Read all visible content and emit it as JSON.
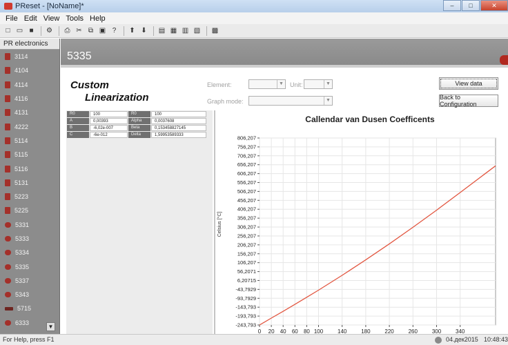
{
  "window": {
    "title": "PReset - [NoName]*",
    "controls": {
      "minimize": "–",
      "maximize": "□",
      "close": "✕"
    }
  },
  "menu": [
    "File",
    "Edit",
    "View",
    "Tools",
    "Help"
  ],
  "toolbar": {
    "icons": [
      "new-icon",
      "open-icon",
      "save-icon",
      "config-icon",
      "print-icon",
      "cut-icon",
      "copy-icon",
      "paste-icon",
      "help-icon",
      "upload-icon",
      "download-icon",
      "view-1-icon",
      "view-2-icon",
      "view-3-icon",
      "view-4-icon",
      "monitor-icon"
    ],
    "glyphs": [
      "□",
      "▭",
      "■",
      "⚙",
      "⎙",
      "✂",
      "⧉",
      "▣",
      "?",
      "⬆",
      "⬇",
      "▤",
      "▦",
      "▥",
      "▧",
      "▩"
    ]
  },
  "sidebar": {
    "header": "PR electronics",
    "items": [
      "3114",
      "4104",
      "4114",
      "4116",
      "4131",
      "4222",
      "5114",
      "5115",
      "5116",
      "5131",
      "5223",
      "5225",
      "5331",
      "5333",
      "5334",
      "5335",
      "5337",
      "5343",
      "5715",
      "6333"
    ],
    "icon_types": [
      "rect",
      "rect",
      "rect",
      "rect",
      "rect",
      "rect",
      "rect",
      "rect",
      "rect",
      "rect",
      "rect",
      "rect",
      "round",
      "round",
      "round",
      "round",
      "round",
      "round",
      "bar",
      "round"
    ],
    "scroll_glyph": "▼"
  },
  "header": {
    "device_number": "5335"
  },
  "panel": {
    "title_line1": "Custom",
    "title_line2": "Linearization",
    "element_label": "Element:",
    "unit_label": "Unit:",
    "graph_mode_label": "Graph mode:",
    "select_arrow": "▼",
    "view_data_button": "View data",
    "back_button": "Back to Configuration"
  },
  "coefficients": [
    {
      "k1": "R0",
      "v1": "100",
      "k2": "R0",
      "v2": "100"
    },
    {
      "k1": "A",
      "v1": "0,00393",
      "k2": "Alpha",
      "v2": "0,0037608"
    },
    {
      "k1": "B",
      "v1": "-6,02e-007",
      "k2": "Beta",
      "v2": "0,153458827145"
    },
    {
      "k1": "C",
      "v1": "-6e-012",
      "k2": "Delta",
      "v2": "1,59953589333"
    }
  ],
  "status": {
    "help_text": "For Help, press F1",
    "date": "04.дек2015",
    "time": "10:48:43"
  },
  "chart_data": {
    "type": "line",
    "title": "Callendar van Dusen Coefficents",
    "xlabel": "",
    "ylabel": "Celsius [°C]",
    "xlim": [
      0,
      400
    ],
    "ylim": [
      -243.793,
      806.207
    ],
    "grid": true,
    "x_ticks": [
      0,
      20,
      40,
      60,
      80,
      100,
      140,
      180,
      220,
      260,
      300,
      340
    ],
    "x_tick_labels": [
      "0",
      "20",
      "40",
      "60",
      "80",
      "100",
      "140",
      "180",
      "220",
      "260",
      "300",
      "340"
    ],
    "y_ticks": [
      -243.793,
      -193.793,
      -143.793,
      -93.7929,
      -43.7929,
      6.20715,
      56.2071,
      106.207,
      156.207,
      206.207,
      256.207,
      306.207,
      356.207,
      406.207,
      456.207,
      506.207,
      556.207,
      606.207,
      656.207,
      706.207,
      756.207,
      806.207
    ],
    "y_tick_labels": [
      "-243,793",
      "-193,793",
      "-143,793",
      "-93,7929",
      "-43,7929",
      "6,20715",
      "56,2071",
      "106,207",
      "156,207",
      "206,207",
      "256,207",
      "306,207",
      "356,207",
      "406,207",
      "456,207",
      "506,207",
      "556,207",
      "606,207",
      "656,207",
      "706,207",
      "756,207",
      "806,207"
    ],
    "line_color": "#e2553f",
    "series": [
      {
        "x": [
          0,
          20,
          40,
          60,
          80,
          100,
          140,
          180,
          220,
          260,
          300,
          340,
          380,
          400
        ],
        "values": [
          -243.793,
          -205,
          -167,
          -128,
          -88,
          -48,
          35,
          122,
          212,
          305,
          401,
          500,
          600,
          650
        ]
      }
    ]
  }
}
